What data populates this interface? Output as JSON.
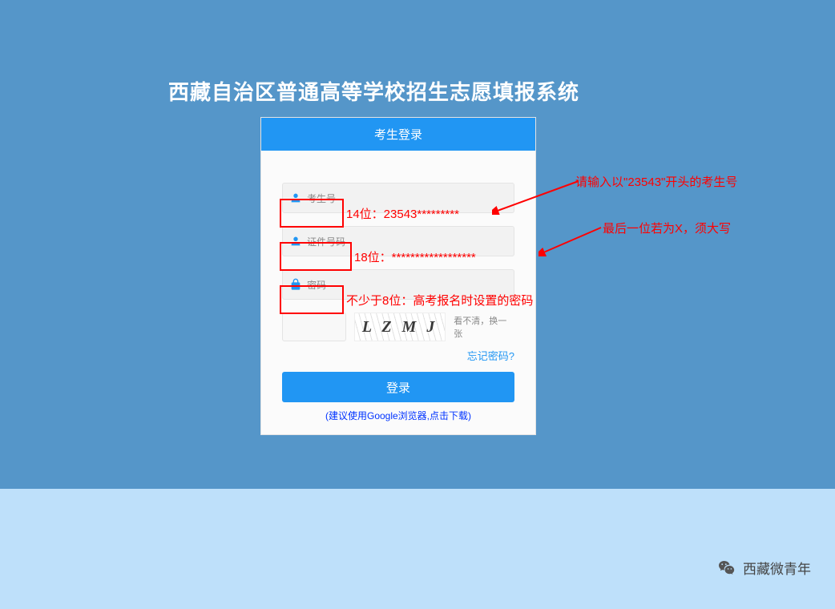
{
  "title": "西藏自治区普通高等学校招生志愿填报系统",
  "login": {
    "header": "考生登录",
    "examineeLabel": "考生号",
    "idLabel": "证件号码",
    "passwordLabel": "密码",
    "captchaText": "L Z M J",
    "captchaRefresh": "看不清，换一张",
    "forgot": "忘记密码?",
    "loginBtn": "登录",
    "browserHint": "(建议使用Google浏览器,点击下载)"
  },
  "annotations": {
    "exam14": "14位：23543*********",
    "id18": "18位：******************",
    "pwd8": "不少于8位：高考报名时设置的密码",
    "tip1": "请输入以\"23543\"开头的考生号",
    "tip2": "最后一位若为X，须大写"
  },
  "footer": {
    "wechat": "西藏微青年"
  },
  "colors": {
    "primary": "#2196f3",
    "bgTop": "#5596c9",
    "bgBottom": "#bee0fa",
    "annotation": "#ff0000"
  }
}
